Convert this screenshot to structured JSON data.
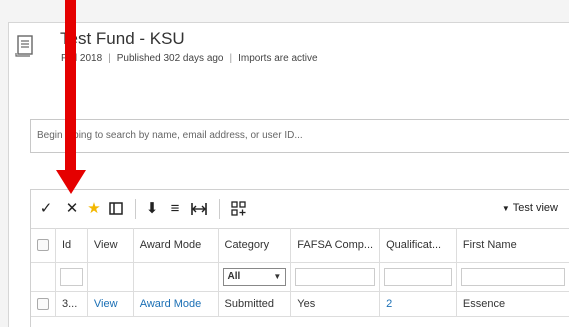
{
  "fund": {
    "title": "Test Fund - KSU",
    "term": "Fall 2018",
    "published": "Published 302 days ago",
    "imports": "Imports are active"
  },
  "search": {
    "placeholder": "Begin typing to search by name, email address, or user ID..."
  },
  "toolbar": {
    "icons": [
      "check-icon",
      "close-icon",
      "star-icon",
      "columns-icon",
      "download-icon",
      "list-icon",
      "expand-icon",
      "add-grid-icon"
    ],
    "view_label": "Test view",
    "star_color": "#f3b700"
  },
  "table": {
    "headers": [
      "Id",
      "View",
      "Award Mode",
      "Category",
      "FAFSA Comp...",
      "Qualificat...",
      "First Name"
    ],
    "filter": {
      "category_value": "All"
    },
    "rows": [
      [
        "3...",
        "View",
        "Award Mode",
        "Submitted",
        "Yes",
        "2",
        "Essence"
      ]
    ]
  },
  "annotation": {
    "arrow_color": "#e50000"
  }
}
